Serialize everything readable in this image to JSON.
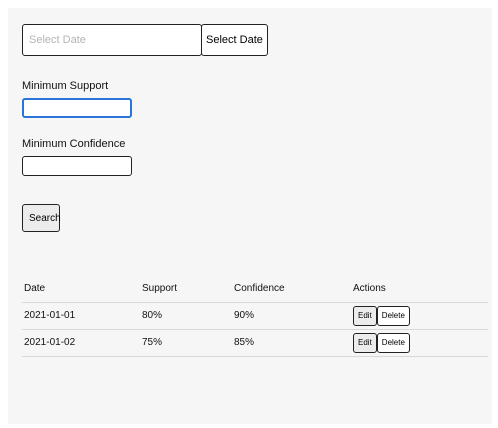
{
  "date_picker": {
    "placeholder": "Select Date",
    "button_label": "Select Date"
  },
  "min_support": {
    "label": "Minimum Support",
    "value": ""
  },
  "min_confidence": {
    "label": "Minimum Confidence",
    "value": ""
  },
  "search_label": "Search",
  "table": {
    "headers": [
      "Date",
      "Support",
      "Confidence",
      "Actions"
    ],
    "rows": [
      {
        "date": "2021-01-01",
        "support": "80%",
        "confidence": "90%",
        "edit": "Edit",
        "delete": "Delete"
      },
      {
        "date": "2021-01-02",
        "support": "75%",
        "confidence": "85%",
        "edit": "Edit",
        "delete": "Delete"
      }
    ]
  },
  "colors": {
    "focus_border": "#2b74d8",
    "panel_bg": "#f6f6f6"
  }
}
